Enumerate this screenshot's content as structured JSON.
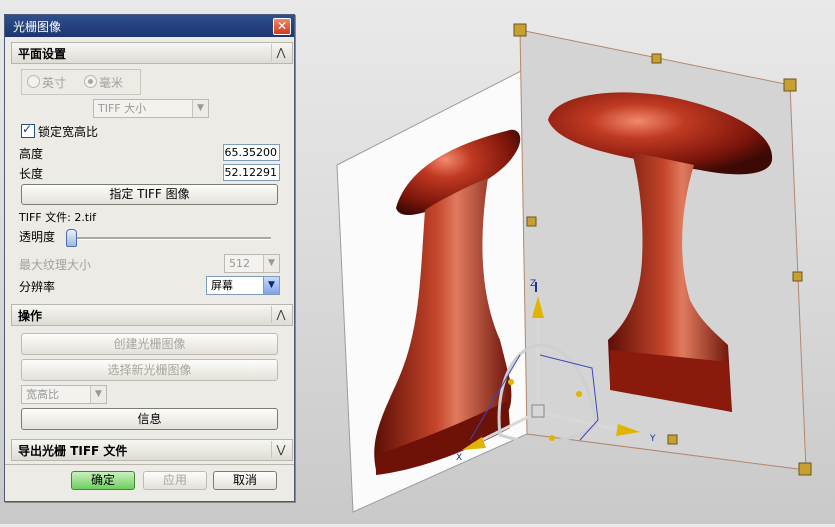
{
  "dialog": {
    "title": "光栅图像",
    "section_plane": "平面设置",
    "unit_options": [
      "英寸",
      "毫米"
    ],
    "unit_selected": "毫米",
    "image_type": "TIFF 大小",
    "lock_aspect_label": "锁定宽高比",
    "lock_aspect_checked": true,
    "height_label": "高度",
    "height_value": "65.35200",
    "length_label": "长度",
    "length_value": "52.12291",
    "specify_tiff_button": "指定 TIFF 图像",
    "tiff_file_text": "TIFF 文件: 2.tif",
    "transparency_label": "透明度",
    "transparency_value": 0,
    "max_texture_label": "最大纹理大小",
    "max_texture_value": "512",
    "resolution_label": "分辨率",
    "resolution_value": "屏幕",
    "section_ops": "操作",
    "create_button": "创建光栅图像",
    "select_new_button": "选择新光栅图像",
    "aspect_combo": "宽高比",
    "info_button": "信息",
    "section_export": "导出光栅 TIFF 文件",
    "ok_button": "确定",
    "apply_button": "应用",
    "cancel_button": "取消"
  },
  "viewport": {
    "axis_labels": {
      "z": "Z",
      "x": "X",
      "y": "Y"
    },
    "colors": {
      "object": "#9a1e10",
      "handle": "#c8a032",
      "axis": "#1e2ea0",
      "frame": "#b4876a"
    }
  }
}
